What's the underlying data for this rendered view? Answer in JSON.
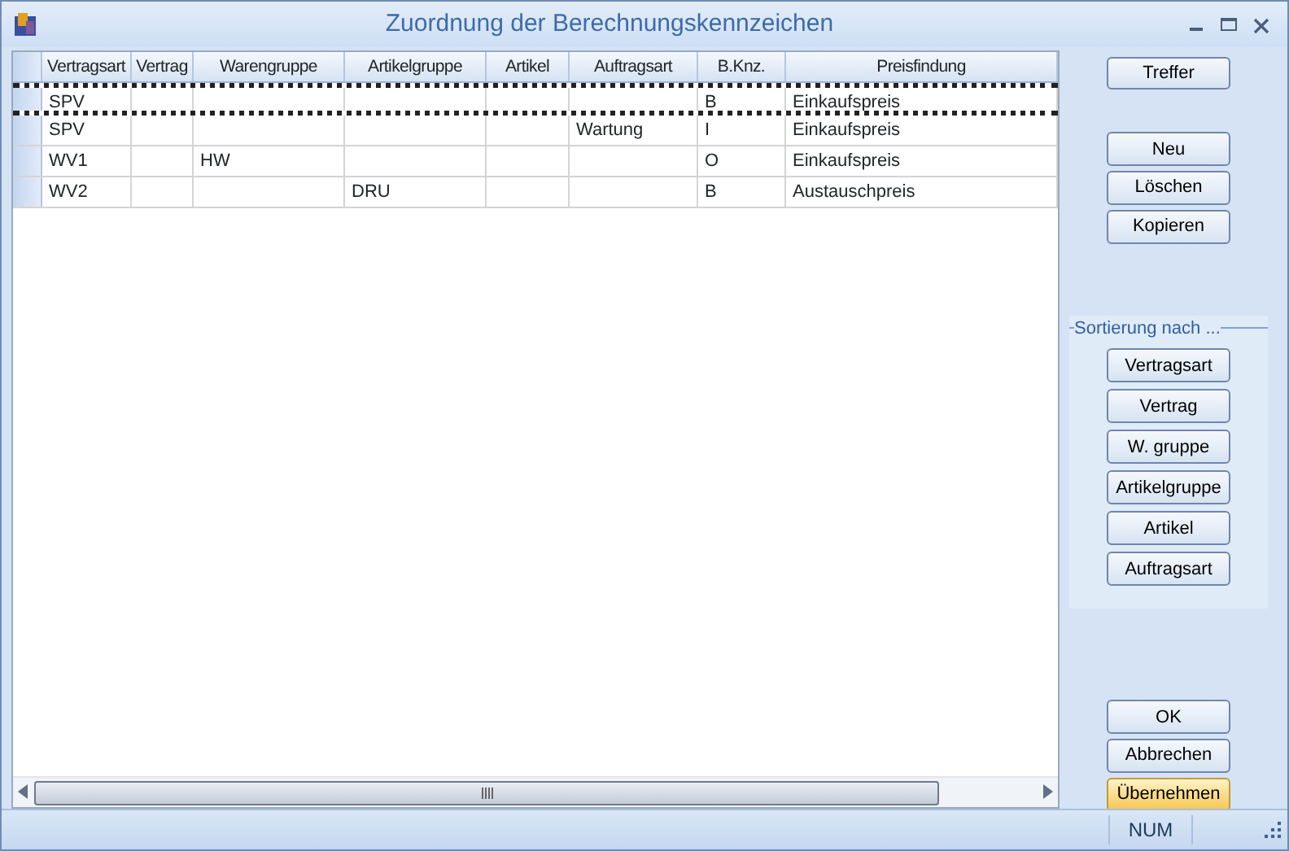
{
  "window": {
    "title": "Zuordnung der Berechnungskennzeichen"
  },
  "table": {
    "columns": [
      "Vertragsart",
      "Vertrag",
      "Warengruppe",
      "Artikelgruppe",
      "Artikel",
      "Auftragsart",
      "B.Knz.",
      "Preisfindung"
    ],
    "rows": [
      {
        "cells": [
          "SPV",
          "",
          "",
          "",
          "",
          "",
          "B",
          "Einkaufspreis"
        ],
        "focused": true
      },
      {
        "cells": [
          "SPV",
          "",
          "",
          "",
          "",
          "Wartung",
          "I",
          "Einkaufspreis"
        ],
        "focused": false
      },
      {
        "cells": [
          "WV1",
          "",
          "HW",
          "",
          "",
          "",
          "O",
          "Einkaufspreis"
        ],
        "focused": false
      },
      {
        "cells": [
          "WV2",
          "",
          "",
          "DRU",
          "",
          "",
          "B",
          "Austauschpreis"
        ],
        "focused": false
      }
    ]
  },
  "top_buttons": [
    "Treffer"
  ],
  "edit_buttons": [
    "Neu",
    "Löschen",
    "Kopieren"
  ],
  "sort_group": {
    "label": "Sortierung nach ...",
    "buttons": [
      "Vertragsart",
      "Vertrag",
      "W. gruppe",
      "Artikelgruppe",
      "Artikel",
      "Auftragsart"
    ]
  },
  "dialog_buttons": [
    {
      "label": "OK",
      "highlighted": false
    },
    {
      "label": "Abbrechen",
      "highlighted": false
    },
    {
      "label": "Übernehmen",
      "highlighted": true
    }
  ],
  "status_bar": {
    "num": "NUM"
  }
}
